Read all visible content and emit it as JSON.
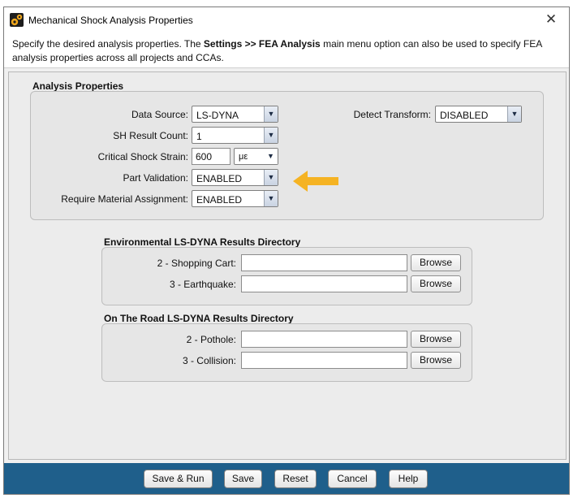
{
  "window": {
    "title": "Mechanical Shock Analysis Properties",
    "close_symbol": "✕"
  },
  "description": {
    "pre": "Specify the desired analysis properties. The ",
    "bold": "Settings >> FEA Analysis",
    "post": " main menu option can also be used to specify FEA analysis properties across all projects and CCAs."
  },
  "analysis": {
    "section_title": "Analysis Properties",
    "data_source_label": "Data Source:",
    "data_source_value": "LS-DYNA",
    "detect_transform_label": "Detect Transform:",
    "detect_transform_value": "DISABLED",
    "sh_result_count_label": "SH Result Count:",
    "sh_result_count_value": "1",
    "critical_strain_label": "Critical Shock Strain:",
    "critical_strain_value": "600",
    "critical_strain_unit": "με",
    "part_validation_label": "Part Validation:",
    "part_validation_value": "ENABLED",
    "require_material_label": "Require Material Assignment:",
    "require_material_value": "ENABLED"
  },
  "environmental": {
    "section_title": "Environmental LS-DYNA Results Directory",
    "rows": [
      {
        "label": "2 - Shopping Cart:",
        "value": "",
        "button": "Browse"
      },
      {
        "label": "3 - Earthquake:",
        "value": "",
        "button": "Browse"
      }
    ]
  },
  "ontheroad": {
    "section_title": "On The Road LS-DYNA Results Directory",
    "rows": [
      {
        "label": "2 - Pothole:",
        "value": "",
        "button": "Browse"
      },
      {
        "label": "3 - Collision:",
        "value": "",
        "button": "Browse"
      }
    ]
  },
  "footer": {
    "save_run": "Save & Run",
    "save": "Save",
    "reset": "Reset",
    "cancel": "Cancel",
    "help": "Help"
  },
  "colors": {
    "footer_bg": "#1f5f8b",
    "annotation_arrow": "#f5b323"
  },
  "icons": {
    "app": "gear-pair-icon",
    "close": "close-icon",
    "dropdown": "chevron-down-icon",
    "annotation": "arrow-left-icon"
  }
}
